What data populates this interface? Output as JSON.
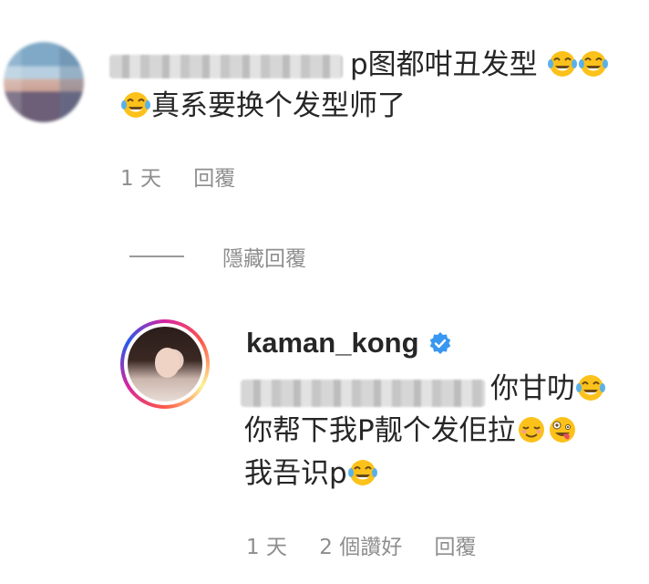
{
  "comment": {
    "text_line1": "p图都咁丑发型",
    "text_line2": "真系要换个发型师了",
    "emojis_line1": [
      "tears-of-joy",
      "tears-of-joy"
    ],
    "emojis_line2_prefix": [
      "tears-of-joy"
    ],
    "time": "1 天",
    "reply_label": "回覆"
  },
  "hidden_replies": {
    "label": "隱藏回覆"
  },
  "reply": {
    "username": "kaman_kong",
    "verified": true,
    "text_line1": "你甘叻",
    "text_line2": "你帮下我P靓个发佢拉",
    "text_line3": "我吾识p",
    "time": "1 天",
    "likes": "2 個讚好",
    "reply_label": "回覆"
  },
  "colors": {
    "text": "#262626",
    "meta": "#8e8e8e",
    "verified": "#3897f0"
  }
}
